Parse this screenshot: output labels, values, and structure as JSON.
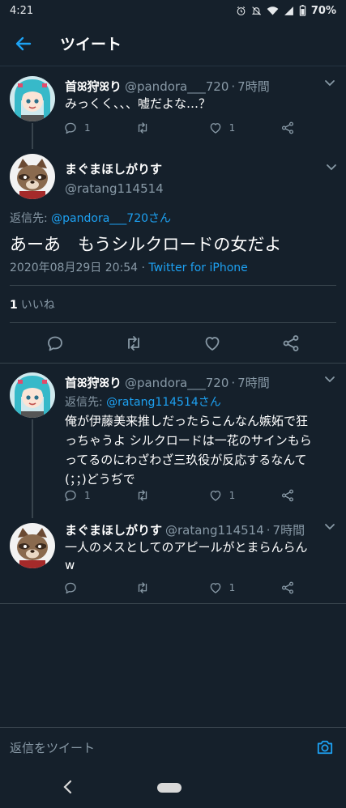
{
  "status_bar": {
    "time": "4:21",
    "battery": "70%"
  },
  "header": {
    "title": "ツイート"
  },
  "tweets": [
    {
      "display_name": "首ꕤ狩ꕤり",
      "handle": "@pandora___720",
      "time_ago": "7時間",
      "text": "みっくく、、、嘘だよな…？",
      "replies": "1",
      "retweets": "",
      "likes": "1"
    }
  ],
  "main_tweet": {
    "display_name": "まぐまほしがりす",
    "handle": "@ratang114514",
    "reply_to_label": "返信先:",
    "reply_to_handle": "@pandora___720さん",
    "text": "あーあ　もうシルクロードの女だよ",
    "datetime": "2020年08月29日 20:54",
    "separator": " · ",
    "source": "Twitter for iPhone",
    "like_count": "1",
    "like_label": "いいね"
  },
  "replies": [
    {
      "display_name": "首ꕤ狩ꕤり",
      "handle": "@pandora___720",
      "time_ago": "7時間",
      "reply_to_label": "返信先:",
      "reply_to_handle": "@ratang114514さん",
      "lines": [
        "俺が伊藤美来推しだったらこんなん嫉妬で狂",
        "っちゃうよ シルクロードは一花のサインもら",
        "ってるのにわざわざ三玖役が反応するなんて",
        "(；；)どうぢで"
      ],
      "replies": "1",
      "retweets": "",
      "likes": "1"
    },
    {
      "display_name": "まぐまほしがりす",
      "handle": "@ratang114514",
      "time_ago": "7時間",
      "lines": [
        "一人のメスとしてのアピールがとまらんらん",
        "w"
      ],
      "replies": "",
      "retweets": "",
      "likes": "1"
    }
  ],
  "composer": {
    "placeholder": "返信をツイート"
  },
  "colors": {
    "background": "#15202b",
    "accent": "#1da1f2",
    "secondary_text": "#8899a6",
    "divider": "#38444d"
  },
  "icons": [
    "back-arrow-icon",
    "reply-icon",
    "retweet-icon",
    "like-icon",
    "share-icon",
    "chevron-down-icon",
    "camera-icon"
  ]
}
